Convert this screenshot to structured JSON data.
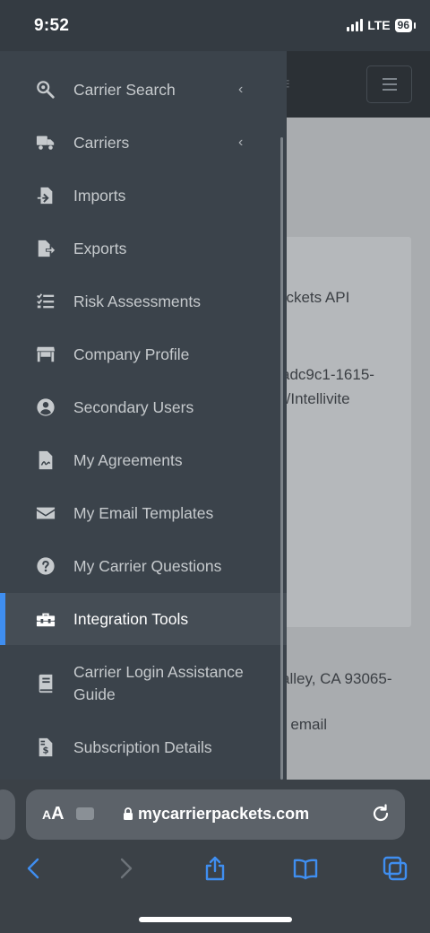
{
  "status": {
    "time": "9:52",
    "network": "LTE",
    "battery": "96"
  },
  "sidebar": {
    "items": [
      {
        "label": "Carrier Search",
        "icon": "search-gear-icon",
        "has_chevron": true
      },
      {
        "label": "Carriers",
        "icon": "truck-icon",
        "has_chevron": true
      },
      {
        "label": "Imports",
        "icon": "file-import-icon",
        "has_chevron": false
      },
      {
        "label": "Exports",
        "icon": "file-export-icon",
        "has_chevron": false
      },
      {
        "label": "Risk Assessments",
        "icon": "checklist-icon",
        "has_chevron": false
      },
      {
        "label": "Company Profile",
        "icon": "store-icon",
        "has_chevron": false
      },
      {
        "label": "Secondary Users",
        "icon": "user-circle-icon",
        "has_chevron": false
      },
      {
        "label": "My Agreements",
        "icon": "signed-document-icon",
        "has_chevron": false
      },
      {
        "label": "My Email Templates",
        "icon": "envelope-icon",
        "has_chevron": false
      },
      {
        "label": "My Carrier Questions",
        "icon": "question-circle-icon",
        "has_chevron": false
      },
      {
        "label": "Integration Tools",
        "icon": "toolbox-icon",
        "has_chevron": false,
        "active": true
      },
      {
        "label": "Carrier Login Assistance Guide",
        "icon": "book-icon",
        "has_chevron": false
      },
      {
        "label": "Subscription Details",
        "icon": "invoice-icon",
        "has_chevron": false
      }
    ],
    "chevron": "‹"
  },
  "background": {
    "line1": "ackets API",
    "line2": "adc9c1-1615-",
    "line3": "r/Intellivite",
    "line4": "alley, CA 93065-",
    "line5": "r email"
  },
  "browser": {
    "aa_small": "A",
    "aa_large": "A",
    "url": "mycarrierpackets.com"
  },
  "colors": {
    "accent": "#3f8ef0",
    "sidebar_bg": "#3b434b",
    "active_bg": "#454d55"
  }
}
